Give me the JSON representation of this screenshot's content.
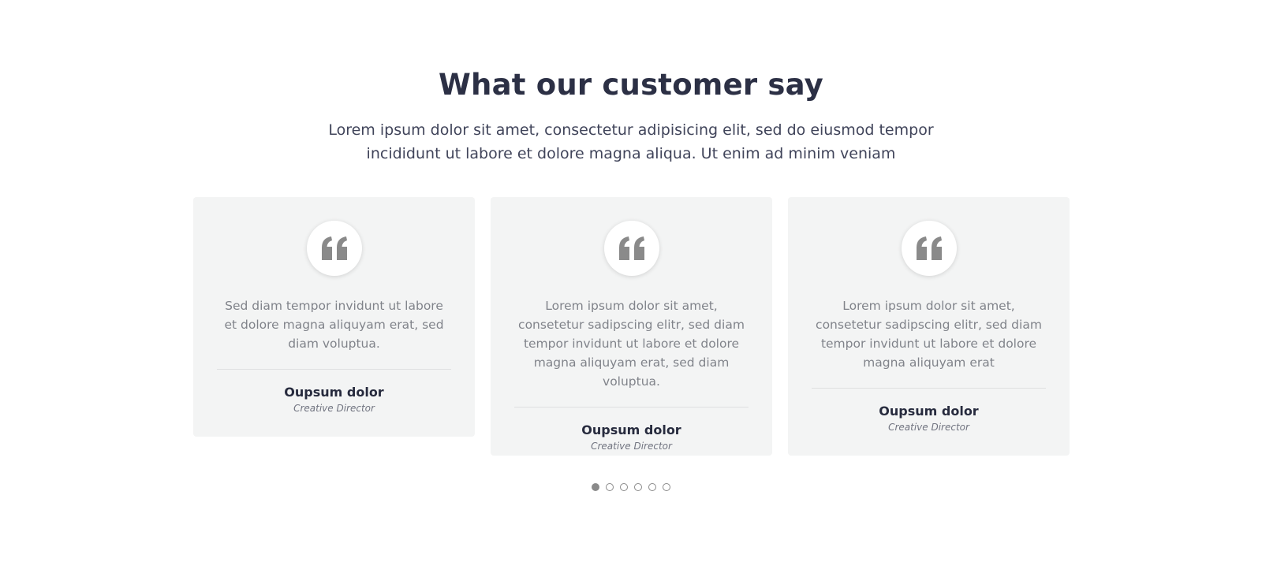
{
  "section": {
    "title": "What our customer say",
    "subtitle": "Lorem ipsum dolor sit amet, consectetur adipisicing elit, sed do eiusmod tempor incididunt ut labore et dolore magna aliqua. Ut enim ad minim veniam"
  },
  "testimonials": [
    {
      "quote": "Sed diam tempor invidunt ut labore et dolore magna aliquyam erat, sed diam voluptua.",
      "name": "Oupsum dolor",
      "role": "Creative Director",
      "icon": "quote-icon"
    },
    {
      "quote": "Lorem ipsum dolor sit amet, consetetur sadipscing elitr, sed diam tempor invidunt ut labore et dolore magna aliquyam erat, sed diam voluptua.",
      "name": "Oupsum dolor",
      "role": "Creative Director",
      "icon": "quote-icon"
    },
    {
      "quote": "Lorem ipsum dolor sit amet, consetetur sadipscing elitr, sed diam tempor invidunt ut labore et dolore magna aliquyam erat",
      "name": "Oupsum dolor",
      "role": "Creative Director",
      "icon": "quote-icon"
    }
  ],
  "pagination": {
    "count": 6,
    "active_index": 0
  },
  "colors": {
    "heading": "#2c3045",
    "card_background": "#f3f4f4",
    "quote_icon": "#8a8a8a",
    "body_text": "#80838a"
  }
}
